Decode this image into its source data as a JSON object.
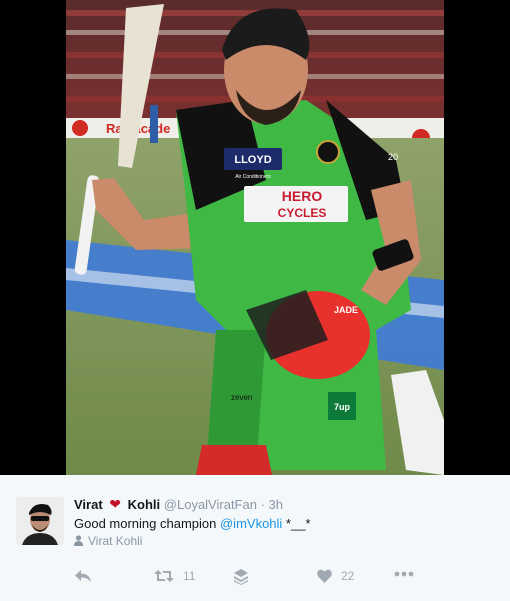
{
  "tweet": {
    "display_name_first": "Virat",
    "heart_emoji": "❤",
    "display_name_last": "Kohli",
    "handle": "@LoyalViratFan",
    "separator": "·",
    "timestamp": "3h",
    "text_before": "Good morning champion ",
    "mention": "@imVkohli",
    "text_after": " *__*",
    "retweeted_by": "Virat Kohli"
  },
  "photo_text": {
    "sponsor": "LLOYD",
    "sponsor_sub": "Air Conditioners",
    "brand_line1": "HERO",
    "brand_line2": "CYCLES",
    "helmet_brand": "JADE",
    "kit_brand": "zeven",
    "shirt_badge": "7up",
    "billboard": "Ra  cacade",
    "shirt_number": "20"
  },
  "actions": {
    "reply_icon": "reply-arrow-icon",
    "retweet_icon": "retweet-icon",
    "retweet_count": "11",
    "stack_icon": "layers-icon",
    "like_icon": "heart-icon",
    "like_count": "22",
    "more_icon": "more-dots-icon"
  },
  "colors": {
    "mention": "#1b95e0",
    "heart": "#c3102b",
    "muted": "#8a98a6",
    "jersey_green": "#3fb844",
    "jersey_black": "#111111",
    "helmet_red": "#e8312c"
  }
}
